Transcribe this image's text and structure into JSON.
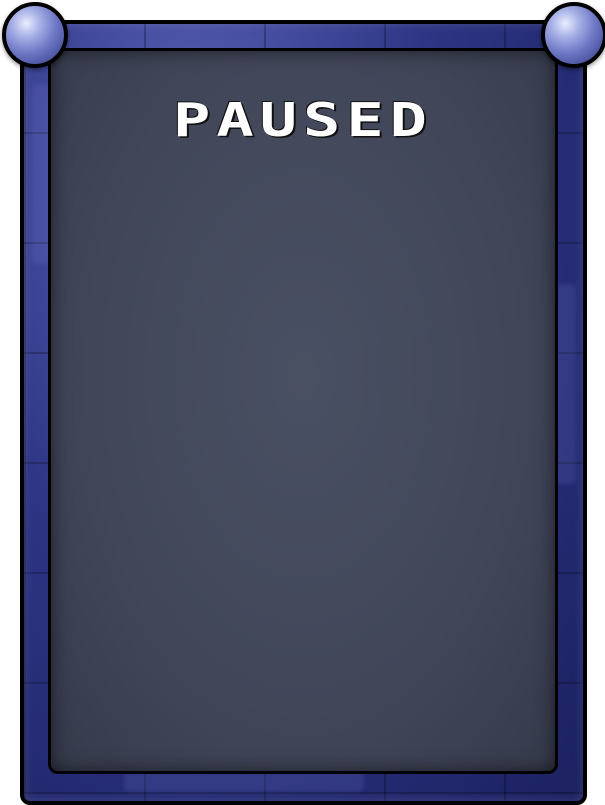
{
  "pause_screen": {
    "title": "PAUSED"
  },
  "decor": {
    "frame_color": "#2d3584",
    "panel_color": "#434859",
    "orb_icon": "crystal-orb-icon"
  }
}
